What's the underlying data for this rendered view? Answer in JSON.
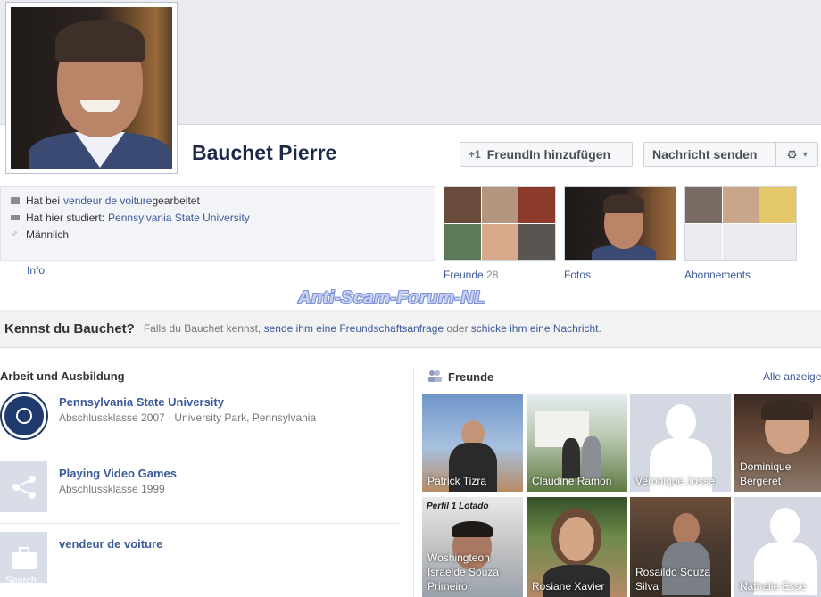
{
  "profile": {
    "name": "Bauchet Pierre"
  },
  "actions": {
    "add_friend_icon": "+1",
    "add_friend": "FreundIn hinzufügen",
    "message": "Nachricht senden",
    "gear_icon": "⚙",
    "caret": "▾"
  },
  "info": {
    "work_prefix": "Hat bei",
    "work_link": "vendeur de voiture",
    "work_suffix": "gearbeitet",
    "study_prefix": "Hat hier studiert:",
    "study_link": "Pennsylvania State University",
    "gender_icon": "♂",
    "gender": "Männlich",
    "tab_label": "Info"
  },
  "tiles": {
    "friends_label": "Freunde",
    "friends_count": "28",
    "photos_label": "Fotos",
    "subscriptions_label": "Abonnements"
  },
  "watermark": "Anti-Scam-Forum-NL",
  "know": {
    "question": "Kennst du Bauchet?",
    "text_a": "Falls du Bauchet kennst,",
    "link_a": "sende ihm eine Freundschaftsanfrage",
    "text_b": "oder",
    "link_b": "schicke ihm eine Nachricht",
    "text_c": "."
  },
  "work_edu": {
    "title": "Arbeit und Ausbildung",
    "items": [
      {
        "title": "Pennsylvania State University",
        "subtitle": "Abschlussklasse 2007 · University Park, Pennsylvania"
      },
      {
        "title": "Playing Video Games",
        "subtitle": "Abschlussklasse 1999"
      },
      {
        "title": "vendeur de voiture",
        "subtitle": ""
      }
    ],
    "partial_logo_text": "Search"
  },
  "friends": {
    "title": "Freunde",
    "all_link": "Alle anzeigen",
    "perfil_tag": "Perfil 1 Lotado",
    "list": [
      {
        "name": "Patrick Tizra",
        "bg": "#6e95c9"
      },
      {
        "name": "Claudine Ramon",
        "bg": "#7d8f6a"
      },
      {
        "name": "Veronique Josse",
        "bg": "silhouette"
      },
      {
        "name": "Dominique Bergeret",
        "bg": "#8a6a52"
      },
      {
        "name": "Woshingteon Israelde Souza Primeiro",
        "bg": "#9aa2ab"
      },
      {
        "name": "Rosiane Xavier",
        "bg": "#b48a6a"
      },
      {
        "name": "Rosaildo Souza Silva",
        "bg": "#5a4a3e"
      },
      {
        "name": "Nathalie Esse",
        "bg": "silhouette"
      }
    ]
  },
  "colors": {
    "link": "#3b5998",
    "name": "#1c2a47",
    "info_bg": "#f3f4f7",
    "silhouette": "#d3d8e3"
  }
}
